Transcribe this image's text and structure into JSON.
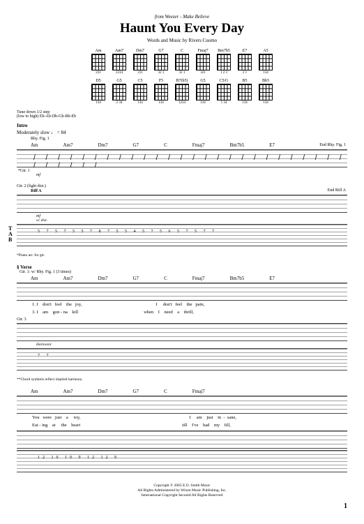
{
  "header": {
    "from": "from Weezer - Make Believe",
    "title": "Haunt You Every Day",
    "credit": "Words and Music by Rivers Cuomo"
  },
  "chordRow1": [
    {
      "n": "Am",
      "f": "231"
    },
    {
      "n": "Am7",
      "f": "2314"
    },
    {
      "n": "Dm7",
      "f": "211"
    },
    {
      "n": "G7",
      "f": "32 1"
    },
    {
      "n": "C",
      "f": "32 1"
    },
    {
      "n": "Fmaj7",
      "f": "321"
    },
    {
      "n": "Bm7b5",
      "f": "1 2 3"
    },
    {
      "n": "E7",
      "f": "2 1"
    },
    {
      "n": "A5",
      "f": "134"
    }
  ],
  "chordRow2": [
    {
      "n": "D5",
      "f": "134"
    },
    {
      "n": "G5",
      "f": "2 34"
    },
    {
      "n": "C5",
      "f": "134"
    },
    {
      "n": "F5",
      "f": "134"
    },
    {
      "n": "B7(b5)",
      "f": "1234"
    },
    {
      "n": "G5",
      "f": "134"
    },
    {
      "n": "C5/G",
      "f": "1 34"
    },
    {
      "n": "B5",
      "f": "134"
    },
    {
      "n": "Bb5",
      "f": "134"
    }
  ],
  "tuning": {
    "l1": "Tune down 1/2 step",
    "l2": "(low to high) Eb-Ab-Db-Gb-Bb-Eb"
  },
  "intro": {
    "section": "Intro",
    "tempo": "Moderately slow ♩ = 84",
    "rhyfig": "Rhy. Fig. 1",
    "endrhy": "End Rhy. Fig. 1",
    "gtr1": "*Gtr. 1",
    "dyn": "mf",
    "chords": [
      "Am",
      "Am7",
      "Dm7",
      "G7",
      "C",
      "Fmaj7",
      "Bm7b5",
      "E7"
    ]
  },
  "riffA": {
    "label": "Riff A",
    "gtr": "Gtr. 2 (light dist.)",
    "dyn": "mf",
    "dist": "w/ dist.",
    "endriff": "End Riff A",
    "tabnums": "5 7 5  7 5  5 7  8 7 5  5 4 5 7  5  6 5  7 5 7  7",
    "pianofoot": "*Piano arr. for gtr."
  },
  "verse": {
    "section": "Verse",
    "gtrnote": "Gtr. 1: w/ Rhy. Fig. 1 (3 times)",
    "chords1": [
      "Am",
      "Am7",
      "Dm7",
      "G7",
      "C",
      "Fmaj7",
      "Bm7b5",
      "E7"
    ],
    "lyrics1a": "1. I    don't   feel    the   joy,",
    "lyrics1b": "     I     don't   feel    the   pain,",
    "lyrics2a": "3. I    am    gon - na    kill",
    "lyrics2b": "     when    I    need    a    thrill,",
    "gtr3": "Gtr. 3",
    "harm": "Harmonic",
    "tabnums": "7                                7",
    "chordfoot": "**Chord symbols reflect implied harmony."
  },
  "verse2": {
    "chords": [
      "Am",
      "Am7",
      "Dm7",
      "G7",
      "C",
      "Fmaj7"
    ],
    "lyricsA": "You   were   just    a     toy,",
    "lyricsB": "     I     am    just    in  -  sane,",
    "lyricsC": "Eat - ing    at     the    heart",
    "lyricsD": "     till    I've    had    my    fill,",
    "tabnums": "12          10           10            9    12        12     9"
  },
  "copyright": {
    "l1": "Copyright © 2005 E.O. Smith Music",
    "l2": "All Rights Administered by Wixen Music Publishing, Inc.",
    "l3": "International Copyright Secured   All Rights Reserved"
  },
  "page": "1"
}
